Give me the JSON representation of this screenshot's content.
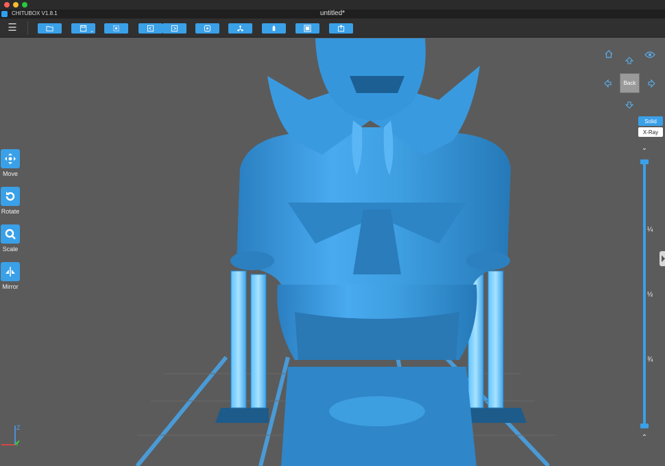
{
  "app": {
    "name": "CHITUBOX V1.8.1",
    "document_title": "untitled*"
  },
  "toolbar": {
    "menu_icon": "hamburger-icon",
    "buttons": [
      {
        "name": "open-file-button",
        "icon": "folder-icon"
      },
      {
        "name": "save-button",
        "icon": "save-icon"
      },
      {
        "name": "select-all-button",
        "icon": "select-icon"
      },
      {
        "name": "undo-button",
        "icon": "undo-icon"
      },
      {
        "name": "redo-button",
        "icon": "redo-icon"
      },
      {
        "name": "settings-button",
        "icon": "settings-icon"
      },
      {
        "name": "support-button",
        "icon": "support-icon"
      },
      {
        "name": "hollow-button",
        "icon": "hollow-icon"
      },
      {
        "name": "slice-button",
        "icon": "slice-icon"
      },
      {
        "name": "export-button",
        "icon": "export-icon"
      }
    ]
  },
  "left_tools": [
    {
      "label": "Move",
      "icon": "move-icon"
    },
    {
      "label": "Rotate",
      "icon": "rotate-icon"
    },
    {
      "label": "Scale",
      "icon": "scale-icon"
    },
    {
      "label": "Mirror",
      "icon": "mirror-icon"
    }
  ],
  "view_cube": {
    "center_label": "Back",
    "icons": [
      "home-icon",
      "eye-icon",
      "arrow-up-icon",
      "arrow-left-icon",
      "arrow-right-icon",
      "arrow-down-icon"
    ]
  },
  "render_modes": {
    "solid": "Solid",
    "xray": "X-Ray",
    "active": "Solid"
  },
  "layer_slider": {
    "marks": [
      "¼",
      "½",
      "¾"
    ],
    "top_arrow": "chevron-down-icon",
    "bottom_arrow": "chevron-up-icon"
  },
  "axes": {
    "z": "Z",
    "y": "Y"
  },
  "colors": {
    "accent": "#3aa0e8",
    "model": "#3d9ee0",
    "background": "#5b5b5b",
    "toolbar": "#303030",
    "grid": "#4a9ad6"
  }
}
